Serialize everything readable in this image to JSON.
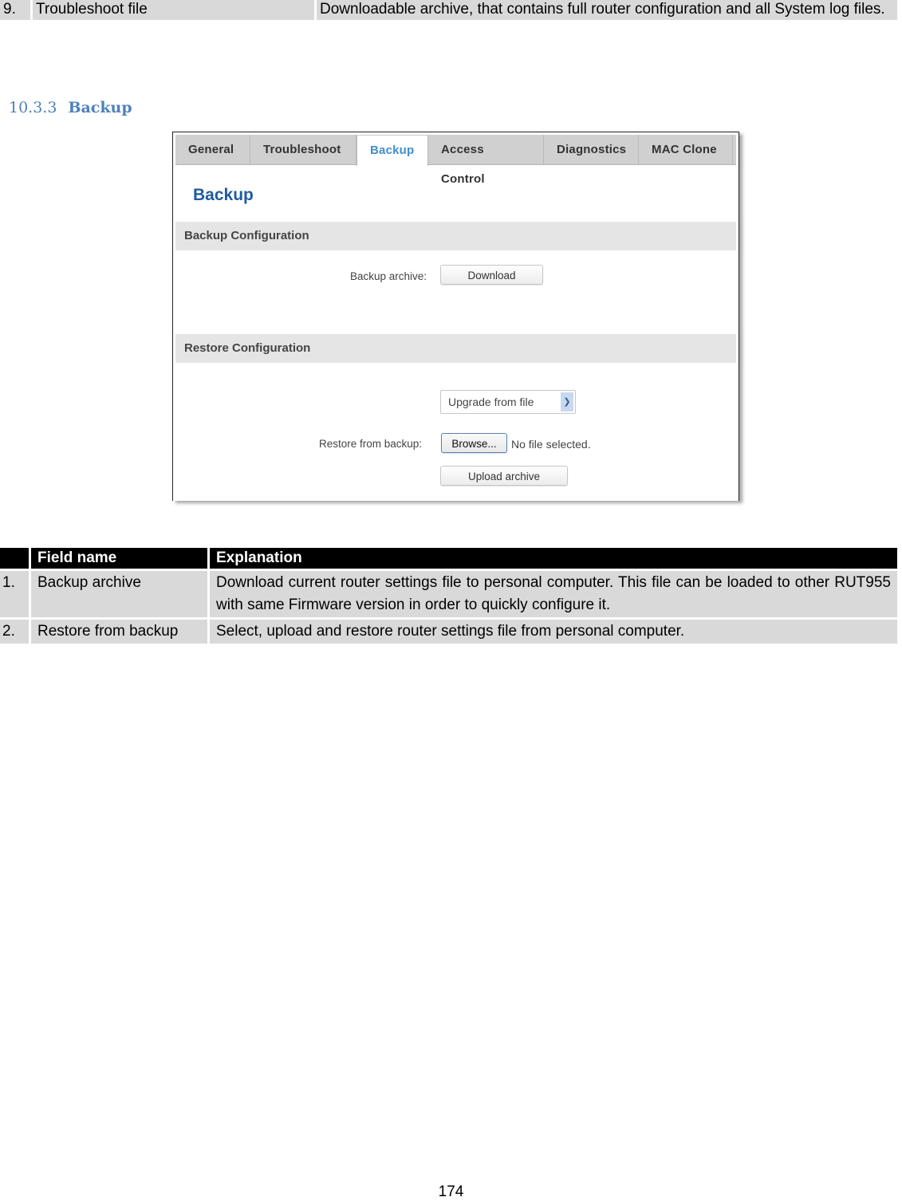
{
  "top_table": {
    "rows": [
      {
        "num": "9.",
        "field": "Troubleshoot file",
        "explanation": "Downloadable archive, that contains full router configuration and all System log files."
      }
    ]
  },
  "section": {
    "number": "10.3.3",
    "title": "Backup"
  },
  "screenshot": {
    "tabs": [
      {
        "label": "General",
        "active": false
      },
      {
        "label": "Troubleshoot",
        "active": false
      },
      {
        "label": "Backup",
        "active": true
      },
      {
        "label": "Access Control",
        "active": false
      },
      {
        "label": "Diagnostics",
        "active": false
      },
      {
        "label": "MAC Clone",
        "active": false
      }
    ],
    "panel_title": "Backup",
    "backup_section": {
      "title": "Backup Configuration",
      "archive_label": "Backup archive:",
      "download_button": "Download"
    },
    "restore_section": {
      "title": "Restore Configuration",
      "mode_select": {
        "selected": "Upgrade from file"
      },
      "restore_label": "Restore from backup:",
      "browse_button": "Browse...",
      "file_status": "No file selected.",
      "upload_button": "Upload archive"
    },
    "colors": {
      "active_tab": "#3e8ed0",
      "panel_title": "#1f5b9e",
      "section_bar": "#e5e5e5"
    }
  },
  "explanation_table": {
    "headers": [
      "",
      "Field name",
      "Explanation"
    ],
    "rows": [
      {
        "num": "1.",
        "field": "Backup archive",
        "explanation": "Download current router settings file to personal computer. This file can be loaded to other RUT955 with same Firmware version in order to quickly configure it."
      },
      {
        "num": "2.",
        "field": "Restore from backup",
        "explanation": "Select, upload and restore router settings file from personal computer."
      }
    ]
  },
  "page_number": "174",
  "heading_color": "#4f81bd"
}
